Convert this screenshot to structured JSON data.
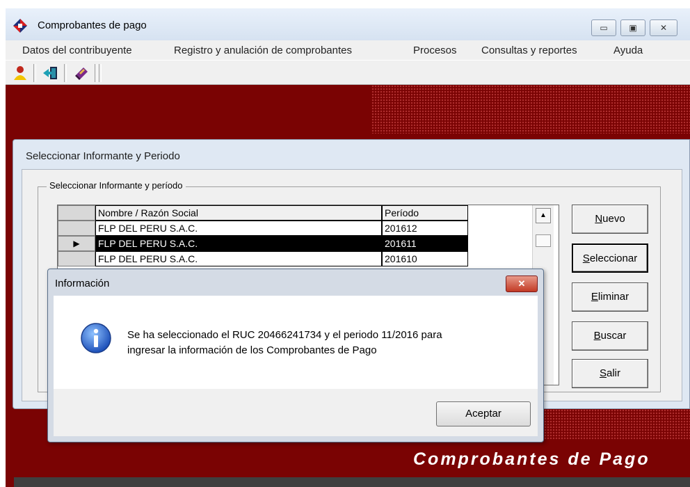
{
  "window": {
    "title": "Comprobantes de pago",
    "controls": {
      "minimize": "▭",
      "maximize": "▣",
      "close": "✕"
    }
  },
  "menu": {
    "items": [
      "Datos del contribuyente",
      "Registro y anulación de comprobantes",
      "Procesos",
      "Consultas y reportes",
      "Ayuda"
    ]
  },
  "toolbar": {
    "buttons": [
      {
        "icon": "user-icon"
      },
      {
        "icon": "exit-door-icon"
      },
      {
        "icon": "book-icon"
      }
    ]
  },
  "banner": {
    "caption": "Comprobantes de Pago",
    "background": "#7a0303",
    "dot_color": "#b03030"
  },
  "selector_dialog": {
    "title": "Seleccionar Informante y Periodo",
    "group_label": "Seleccionar Informante y período",
    "grid": {
      "columns": [
        "Nombre / Razón Social",
        "Período"
      ],
      "rows": [
        {
          "name": "FLP DEL PERU S.A.C.",
          "period": "201612",
          "selected": false
        },
        {
          "name": "FLP DEL PERU S.A.C.",
          "period": "201611",
          "selected": true
        },
        {
          "name": "FLP DEL PERU S.A.C.",
          "period": "201610",
          "selected": false
        }
      ],
      "row_pointer": "▶",
      "scroll_up": "▲"
    },
    "buttons": {
      "nuevo": {
        "accel": "N",
        "rest": "uevo"
      },
      "seleccionar": {
        "accel": "S",
        "rest": "eleccionar"
      },
      "eliminar": {
        "accel": "E",
        "rest": "liminar"
      },
      "buscar": {
        "accel": "B",
        "rest": "uscar"
      },
      "salir": {
        "accel": "S",
        "rest": "alir"
      }
    }
  },
  "info_box": {
    "title": "Información",
    "close_glyph": "✕",
    "icon": "information-icon",
    "message_line1": "Se ha seleccionado el RUC 20466241734 y el periodo 11/2016 para",
    "message_line2": "ingresar la información de los Comprobantes de Pago",
    "accept_label": "Aceptar"
  }
}
